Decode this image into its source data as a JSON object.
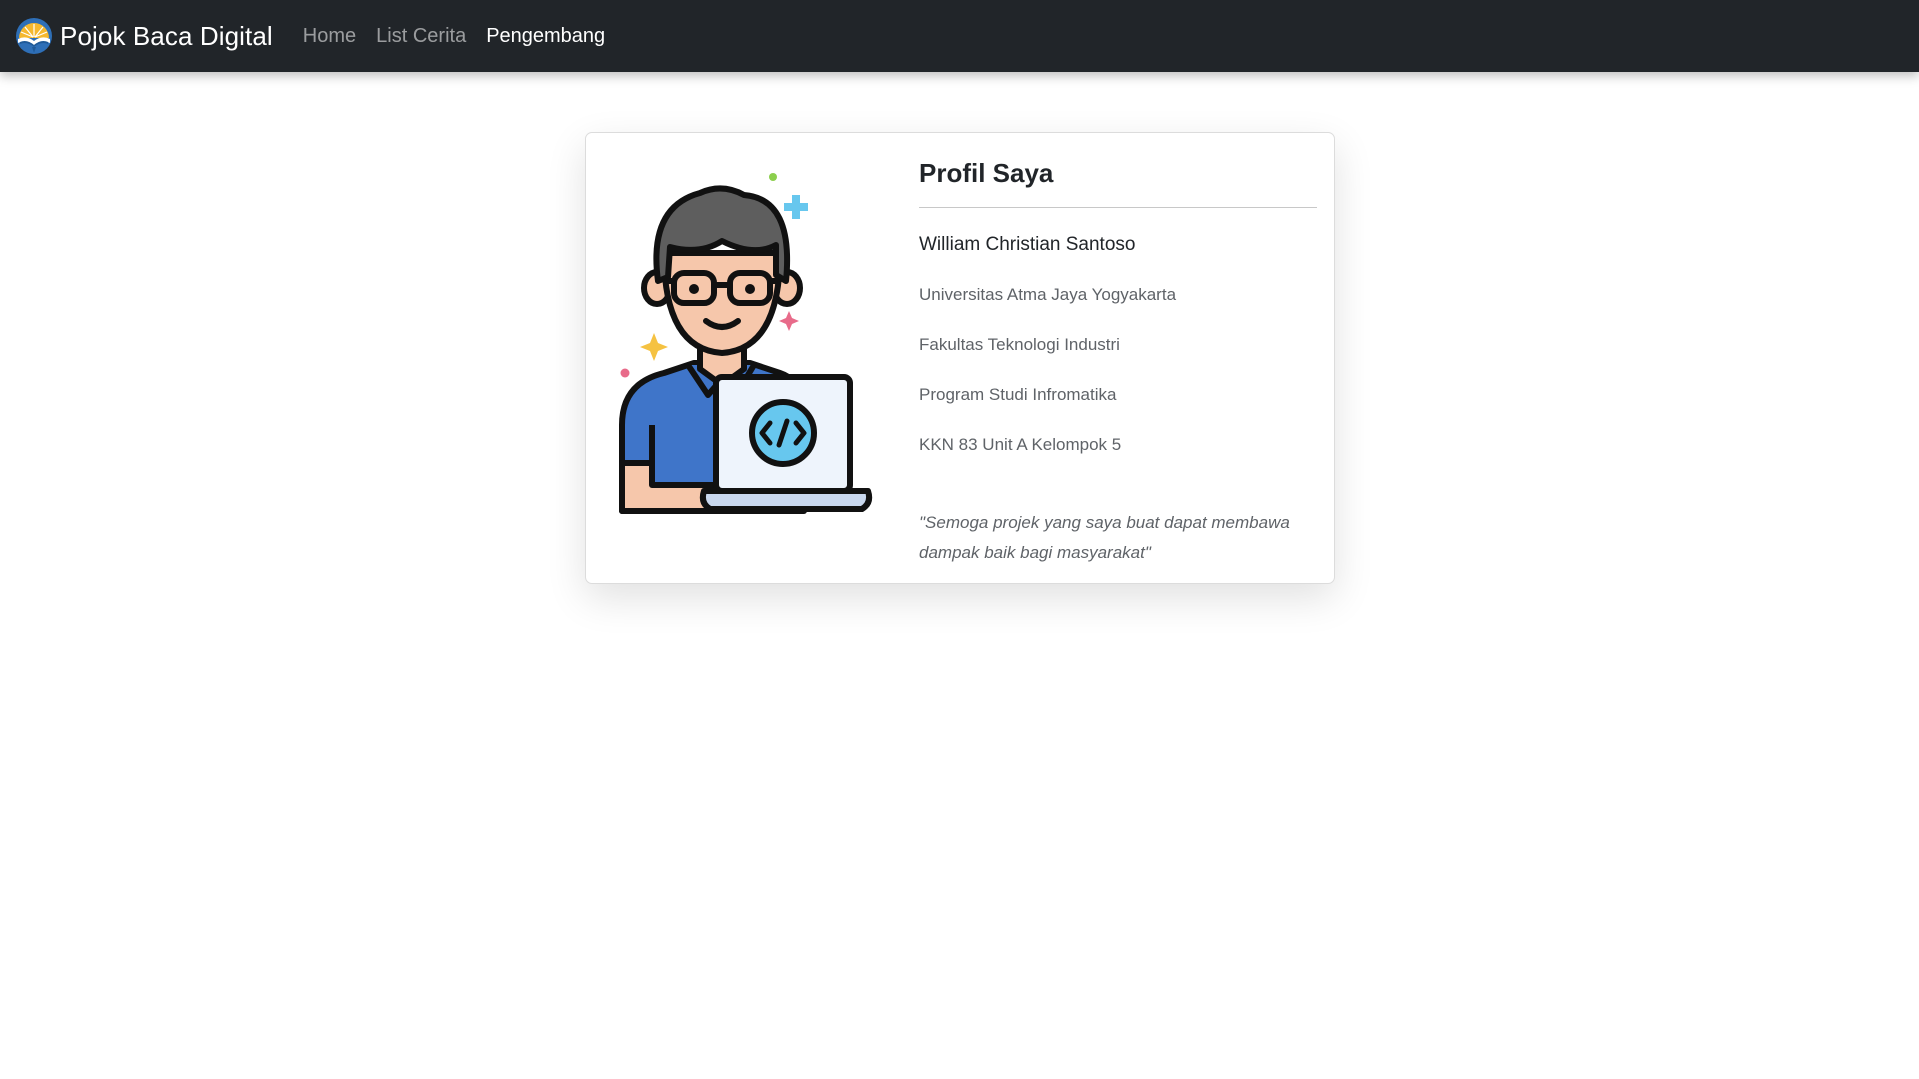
{
  "navbar": {
    "brand": "Pojok Baca Digital",
    "brand_logo_icon": "book-sun-logo-icon",
    "links": [
      {
        "label": "Home",
        "active": false
      },
      {
        "label": "List Cerita",
        "active": false
      },
      {
        "label": "Pengembang",
        "active": true
      }
    ],
    "background_color": "#212529"
  },
  "profile": {
    "title": "Profil Saya",
    "name": "William Christian Santoso",
    "details": [
      "Universitas Atma Jaya Yogyakarta",
      "Fakultas Teknologi Industri",
      "Program Studi Infromatika",
      "KKN 83 Unit A Kelompok 5"
    ],
    "quote": "\"Semoga projek yang saya buat dapat membawa dampak baik bagi masyarakat\"",
    "illustration_icon": "developer-with-laptop-illustration-icon"
  }
}
